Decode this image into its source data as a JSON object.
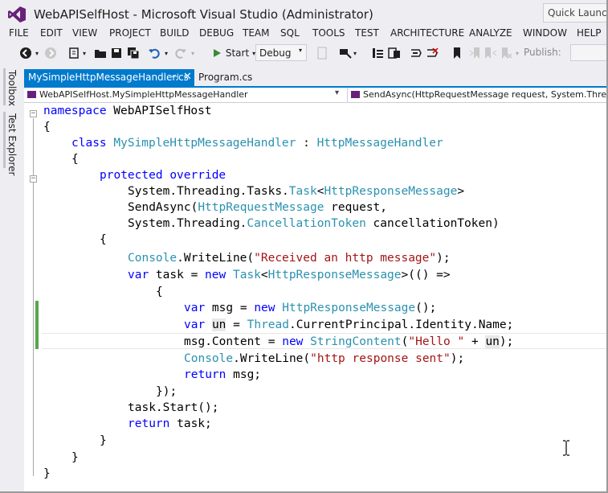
{
  "window": {
    "title": "WebAPISelfHost - Microsoft Visual Studio (Administrator)",
    "quick_launch_placeholder": "Quick Launch"
  },
  "menu": [
    "FILE",
    "EDIT",
    "VIEW",
    "PROJECT",
    "BUILD",
    "DEBUG",
    "TEAM",
    "SQL",
    "TOOLS",
    "TEST",
    "ARCHITECTURE",
    "ANALYZE",
    "WINDOW",
    "HELP"
  ],
  "toolbar": {
    "start_label": "Start",
    "config_value": "Debug",
    "publish_label": "Publish:"
  },
  "side_tabs": [
    "Toolbox",
    "Test Explorer"
  ],
  "tabs": [
    {
      "label": "MySimpleHttpMessageHandler.cs",
      "active": true,
      "pin_icon": "pin-icon",
      "close_icon": "close-icon"
    },
    {
      "label": "Program.cs",
      "active": false
    }
  ],
  "navbar": {
    "type_member": "WebAPISelfHost.MySimpleHttpMessageHandler",
    "method_member": "SendAsync(HttpRequestMessage request, System.Threading.C"
  },
  "code": {
    "l1_kw": "namespace",
    "l1_rest": " WebAPISelfHost",
    "l2": "{",
    "l3_kw": "class",
    "l3_ty1": "MySimpleHttpMessageHandler",
    "l3_mid": " : ",
    "l3_ty2": "HttpMessageHandler",
    "l4": "{",
    "l5_kw1": "protected",
    "l5_kw2": "override",
    "l6_a": "System.Threading.Tasks.",
    "l6_ty1": "Task",
    "l6_b": "<",
    "l6_ty2": "HttpResponseMessage",
    "l6_c": ">",
    "l7_a": "SendAsync(",
    "l7_ty": "HttpRequestMessage",
    "l7_b": " request,",
    "l8_a": "System.Threading.",
    "l8_ty": "CancellationToken",
    "l8_b": " cancellationToken)",
    "l9": "{",
    "l10_ty": "Console",
    "l10_a": ".WriteLine(",
    "l10_st": "\"Received an http message\"",
    "l10_b": ");",
    "l11_kw1": "var",
    "l11_a": " task = ",
    "l11_kw2": "new",
    "l11_ty1": "Task",
    "l11_b": "<",
    "l11_ty2": "HttpResponseMessage",
    "l11_c": ">(() =>",
    "l12": "{",
    "l13_kw1": "var",
    "l13_a": " msg = ",
    "l13_kw2": "new",
    "l13_ty": "HttpResponseMessage",
    "l13_b": "();",
    "l14_kw": "var",
    "l14_hl": "un",
    "l14_a": " = ",
    "l14_ty": "Thread",
    "l14_b": ".CurrentPrincipal.Identity.Name;",
    "l15_a": "msg.Content = ",
    "l15_kw": "new",
    "l15_ty": "StringContent",
    "l15_b": "(",
    "l15_st": "\"Hello \"",
    "l15_c": " + ",
    "l15_hl": "un",
    "l15_d": ");",
    "l16_ty": "Console",
    "l16_a": ".WriteLine(",
    "l16_st": "\"http response sent\"",
    "l16_b": ");",
    "l17_kw": "return",
    "l17_a": " msg;",
    "l18": "});",
    "l19": "task.Start();",
    "l20_kw": "return",
    "l20_a": " task;",
    "l21": "}",
    "l22": "}",
    "l23": "}"
  },
  "colors": {
    "accent": "#007acc",
    "keyword": "#0000ff",
    "type": "#2b91af",
    "string": "#a31515",
    "change_margin": "#57a64a"
  }
}
